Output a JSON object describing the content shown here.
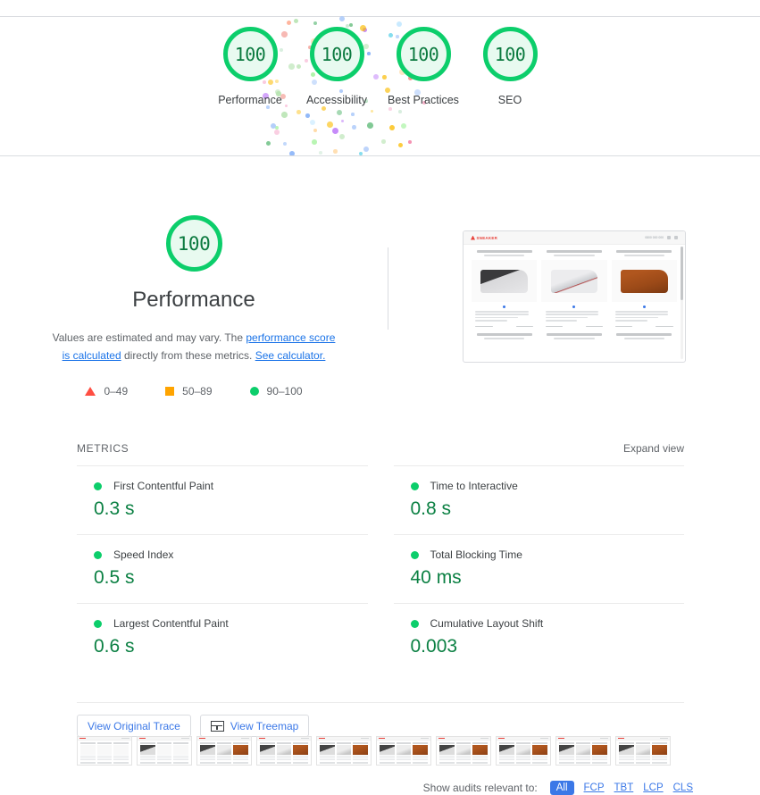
{
  "scores": {
    "categories": [
      {
        "label": "Performance",
        "value": "100"
      },
      {
        "label": "Accessibility",
        "value": "100"
      },
      {
        "label": "Best Practices",
        "value": "100"
      },
      {
        "label": "SEO",
        "value": "100"
      }
    ]
  },
  "performance": {
    "gauge_value": "100",
    "title": "Performance",
    "desc_part1": "Values are estimated and may vary. The ",
    "link_score": "performance score is calculated",
    "desc_part2": " directly from these metrics. ",
    "link_calculator": "See calculator.",
    "legend": [
      {
        "icon": "triangle-icon",
        "range": "0–49"
      },
      {
        "icon": "square-icon",
        "range": "50–89"
      },
      {
        "icon": "circle-icon",
        "range": "90–100"
      }
    ]
  },
  "metrics_section": {
    "title": "METRICS",
    "expand_label": "Expand view",
    "items": [
      {
        "name": "First Contentful Paint",
        "value": "0.3 s",
        "status": "pass"
      },
      {
        "name": "Time to Interactive",
        "value": "0.8 s",
        "status": "pass"
      },
      {
        "name": "Speed Index",
        "value": "0.5 s",
        "status": "pass"
      },
      {
        "name": "Total Blocking Time",
        "value": "40 ms",
        "status": "pass"
      },
      {
        "name": "Largest Contentful Paint",
        "value": "0.6 s",
        "status": "pass"
      },
      {
        "name": "Cumulative Layout Shift",
        "value": "0.003",
        "status": "pass"
      }
    ]
  },
  "buttons": {
    "original_trace": "View Original Trace",
    "treemap": "View Treemap"
  },
  "filmstrip": {
    "frames": [
      {
        "state": "blank"
      },
      {
        "state": "partial"
      },
      {
        "state": "loaded"
      },
      {
        "state": "loaded"
      },
      {
        "state": "loaded"
      },
      {
        "state": "loaded"
      },
      {
        "state": "loaded"
      },
      {
        "state": "loaded"
      },
      {
        "state": "loaded"
      },
      {
        "state": "loaded"
      }
    ]
  },
  "filter": {
    "label": "Show audits relevant to:",
    "options": [
      "All",
      "FCP",
      "TBT",
      "LCP",
      "CLS"
    ],
    "selected": "All"
  },
  "colors": {
    "pass_green": "#0cce6b",
    "average_orange": "#ffa400",
    "fail_red": "#ff4e42",
    "link_blue": "#3b78e7",
    "score_text_green": "#0b8043"
  }
}
